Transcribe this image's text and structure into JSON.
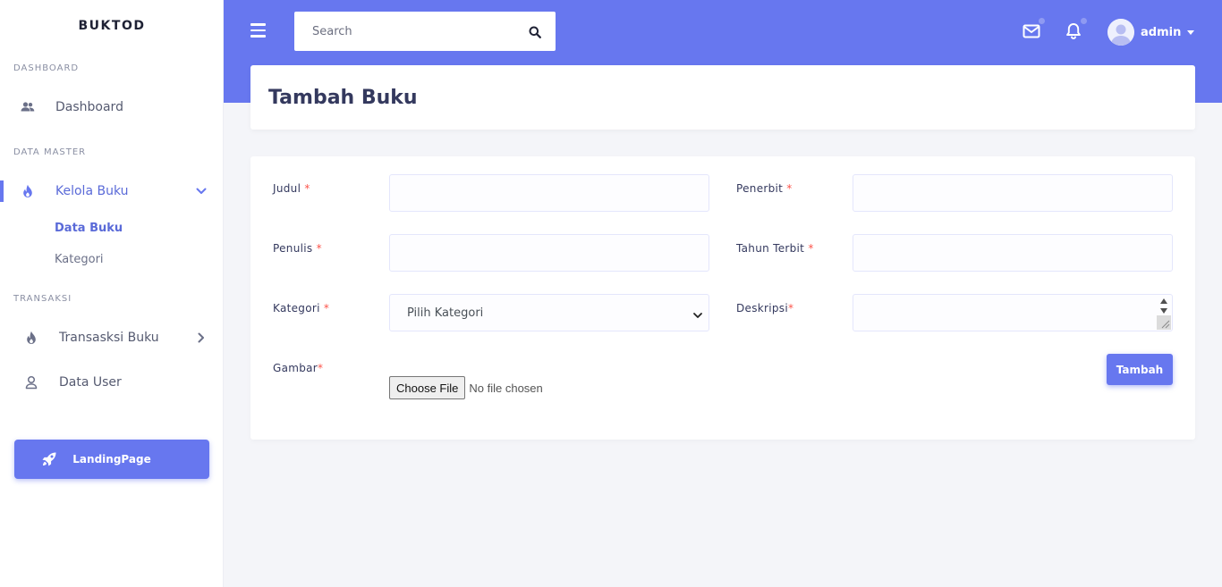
{
  "brand": "BUKTOD",
  "sidebar": {
    "sections": [
      {
        "label": "DASHBOARD"
      },
      {
        "label": "DATA MASTER"
      },
      {
        "label": "TRANSAKSI"
      }
    ],
    "items": [
      {
        "label": "Dashboard",
        "icon": "users-icon"
      },
      {
        "label": "Kelola Buku",
        "icon": "fire-icon",
        "active": true,
        "expanded": true
      },
      {
        "label": "Transasksi Buku",
        "icon": "fire-icon"
      },
      {
        "label": "Data User",
        "icon": "user-icon"
      }
    ],
    "sub_items": [
      {
        "label": "Data Buku",
        "active": true
      },
      {
        "label": "Kategori"
      }
    ],
    "landing_button": {
      "label": "LandingPage",
      "icon": "rocket-icon"
    }
  },
  "header": {
    "search": {
      "placeholder": "Search",
      "value": ""
    },
    "user": {
      "name": "admin"
    }
  },
  "page": {
    "title": "Tambah Buku"
  },
  "form": {
    "judul": {
      "label": "Judul",
      "required": "*",
      "value": ""
    },
    "penerbit": {
      "label": "Penerbit",
      "required": "*",
      "value": ""
    },
    "penulis": {
      "label": "Penulis",
      "required": "*",
      "value": ""
    },
    "tahun_terbit": {
      "label": "Tahun Terbit",
      "required": "*",
      "value": ""
    },
    "kategori": {
      "label": "Kategori",
      "required": "*",
      "selected": "Pilih Kategori"
    },
    "deskripsi": {
      "label": "Deskripsi",
      "required": "*",
      "value": ""
    },
    "gambar": {
      "label": "Gambar",
      "required": "*",
      "button": "Choose File",
      "status": "No file chosen"
    },
    "submit": "Tambah"
  },
  "colors": {
    "accent": "#6777ef",
    "required": "#fc544b",
    "background": "#f4f5f9"
  }
}
